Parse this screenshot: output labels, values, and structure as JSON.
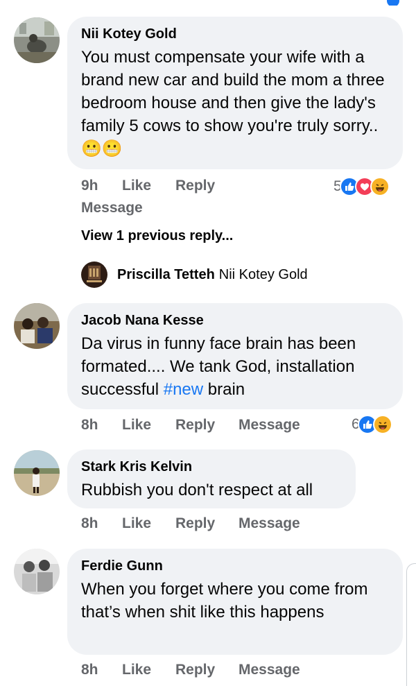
{
  "comments": [
    {
      "author": "Nii Kotey Gold",
      "text": "You must compensate your wife with a brand new car and build the mom a three bedroom house and then give the lady's family 5 cows to show you're truly sorry.. ",
      "emoji": "😬😬",
      "time": "9h",
      "like": "Like",
      "reply": "Reply",
      "message": "Message",
      "reaction_count": "5",
      "reactions": [
        "like",
        "love",
        "haha"
      ]
    },
    {
      "author": "Jacob Nana Kesse",
      "text_before": "Da virus in funny face brain has been formated.... We tank God, installation successful ",
      "hashtag": "#new",
      "text_after": " brain",
      "time": "8h",
      "like": "Like",
      "reply": "Reply",
      "message": "Message",
      "reaction_count": "6",
      "reactions": [
        "like",
        "haha"
      ]
    },
    {
      "author": "Stark Kris Kelvin",
      "text": "Rubbish you don't respect at all",
      "time": "8h",
      "like": "Like",
      "reply": "Reply",
      "message": "Message"
    },
    {
      "author": "Ferdie Gunn",
      "text": "When you forget where you come from that’s when shit like this happens",
      "time": "8h",
      "like": "Like",
      "reply": "Reply",
      "message": "Message"
    }
  ],
  "view_previous": "View 1 previous reply...",
  "reply_preview": {
    "author": "Priscilla Tetteh",
    "mention": "Nii Kotey Gold"
  },
  "colors": {
    "bubble": "#f0f2f5",
    "meta": "#65676b",
    "link": "#1877f2",
    "like": "#1877f2",
    "love": "#f33e58",
    "haha": "#f7b125"
  },
  "icons": [
    "like-reaction-icon",
    "love-reaction-icon",
    "haha-reaction-icon"
  ]
}
